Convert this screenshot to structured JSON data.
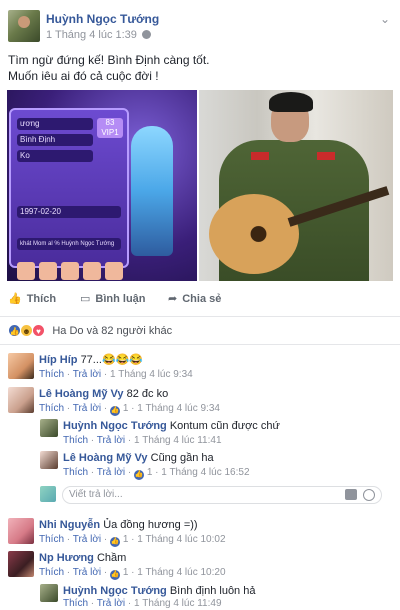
{
  "post": {
    "author": "Huỳnh Ngọc Tướng",
    "time": "1 Tháng 4 lúc 1:39",
    "text_lines": [
      "Tìm ngừ đứng kế! Bình Định càng tốt.",
      "Muốn iêu ai đó cả cuộc đời !"
    ],
    "menu_icon": "chevron-down-icon"
  },
  "photo_left": {
    "rows": [
      "ương",
      "Bình Định",
      "Ko",
      "",
      "1997-02-20"
    ],
    "badge": "VIP1",
    "badge2": "83",
    "caption": "khát Mom al % Huỳnh Ngọc Tướng"
  },
  "actions": {
    "like": "Thích",
    "comment": "Bình luận",
    "share": "Chia sẻ"
  },
  "reactions": {
    "text": "Ha Do và 82 người khác"
  },
  "comments": [
    {
      "name": "Híp Híp",
      "text": "77...😂😂😂",
      "like": "Thích",
      "reply": "Trả lời",
      "time": "1 Tháng 4 lúc 9:34",
      "likes": ""
    },
    {
      "name": "Lê Hoàng Mỹ Vy",
      "text": "82 đc ko",
      "like": "Thích",
      "reply": "Trả lời",
      "likes": "1",
      "time": "1 Tháng 4 lúc 9:34"
    },
    {
      "name": "Huỳnh Ngọc Tướng",
      "text": "Kontum cũn được chứ",
      "like": "Thích",
      "reply": "Trả lời",
      "likes": "",
      "time": "1 Tháng 4 lúc 11:41"
    },
    {
      "name": "Lê Hoàng Mỹ Vy",
      "text": "Cũng gần ha",
      "like": "Thích",
      "reply": "Trả lời",
      "likes": "1",
      "time": "1 Tháng 4 lúc 16:52"
    },
    {
      "name": "Nhi Nguyễn",
      "text": "Ủa đồng hương =))",
      "like": "Thích",
      "reply": "Trả lời",
      "likes": "1",
      "time": "1 Tháng 4 lúc 10:02"
    },
    {
      "name": "Np Hương",
      "text": "Chầm",
      "like": "Thích",
      "reply": "Trả lời",
      "likes": "1",
      "time": "1 Tháng 4 lúc 10:20"
    },
    {
      "name": "Huỳnh Ngọc Tướng",
      "text": "Bình định luôn hả",
      "like": "Thích",
      "reply": "Trả lời",
      "likes": "",
      "time": "1 Tháng 4 lúc 11:49"
    }
  ],
  "reply_box": {
    "placeholder": "Viết trả lời..."
  },
  "colors": {
    "link": "#365899",
    "like_blue": "#4267b2",
    "meta": "#90949c"
  }
}
